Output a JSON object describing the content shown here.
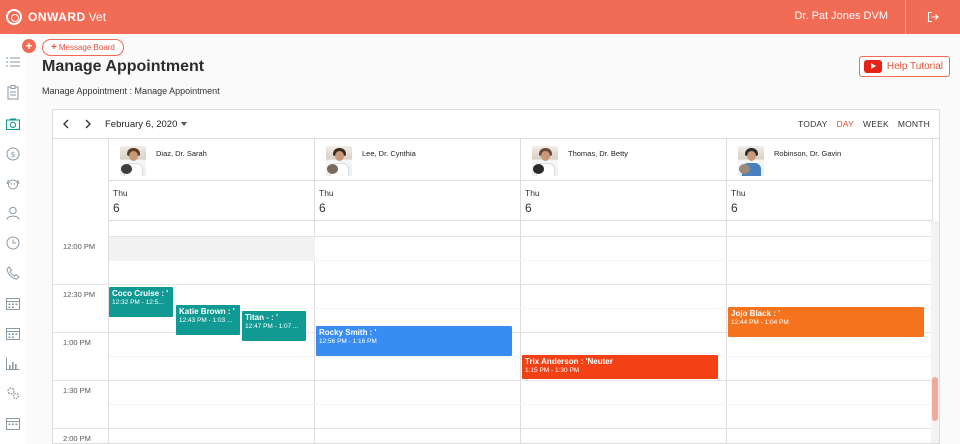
{
  "app": {
    "brand": "ONWARD",
    "brand_sub": "Vet",
    "user_name": "Dr. Pat Jones DVM"
  },
  "sidebar": {
    "icons": [
      "list-icon",
      "clipboard-icon",
      "camera-icon",
      "dollar-icon",
      "dog-icon",
      "user-icon",
      "clock-icon",
      "phone-icon",
      "calendar-icon",
      "calendar-icon",
      "chart-icon",
      "settings-icon",
      "calendar-icon"
    ],
    "active_index": 2
  },
  "page": {
    "message_board": "Message Board",
    "title": "Manage Appointment",
    "breadcrumb": "Manage Appointment : Manage Appointment",
    "help_button": "Help Tutorial"
  },
  "calendar": {
    "date": "February 6, 2020",
    "views": [
      "TODAY",
      "DAY",
      "WEEK",
      "MONTH"
    ],
    "active_view": "DAY",
    "resources": [
      {
        "name": "Diaz, Dr. Sarah",
        "day": "Thu",
        "date": "6"
      },
      {
        "name": "Lee, Dr. Cynthia",
        "day": "Thu",
        "date": "6"
      },
      {
        "name": "Thomas, Dr. Betty",
        "day": "Thu",
        "date": "6"
      },
      {
        "name": "Robinson, Dr. Gavin",
        "day": "Thu",
        "date": "6"
      }
    ],
    "time_labels": [
      "12:00 PM",
      "12:30 PM",
      "1:00 PM",
      "1:30 PM",
      "2:00 PM"
    ],
    "events": [
      {
        "title": "Coco Cruise : '",
        "time": "12:32 PM - 12:5...",
        "color": "#119a93"
      },
      {
        "title": "Katie Brown : '",
        "time": "12:43 PM - 1:03 ...",
        "color": "#119a93"
      },
      {
        "title": "Titan - : '",
        "time": "12:47 PM - 1:07 ...",
        "color": "#119a93"
      },
      {
        "title": "Rocky Smith : '",
        "time": "12:56 PM - 1:16 PM",
        "color": "#3a8df0"
      },
      {
        "title": "Trix Anderson : 'Neuter",
        "time": "1:15 PM - 1:30 PM",
        "color": "#f34115"
      },
      {
        "title": "Jojo Black : '",
        "time": "12:44 PM - 1:04 PM",
        "color": "#f6731e"
      }
    ]
  },
  "colors": {
    "brand": "#f26b55",
    "accent": "#e2513a"
  }
}
